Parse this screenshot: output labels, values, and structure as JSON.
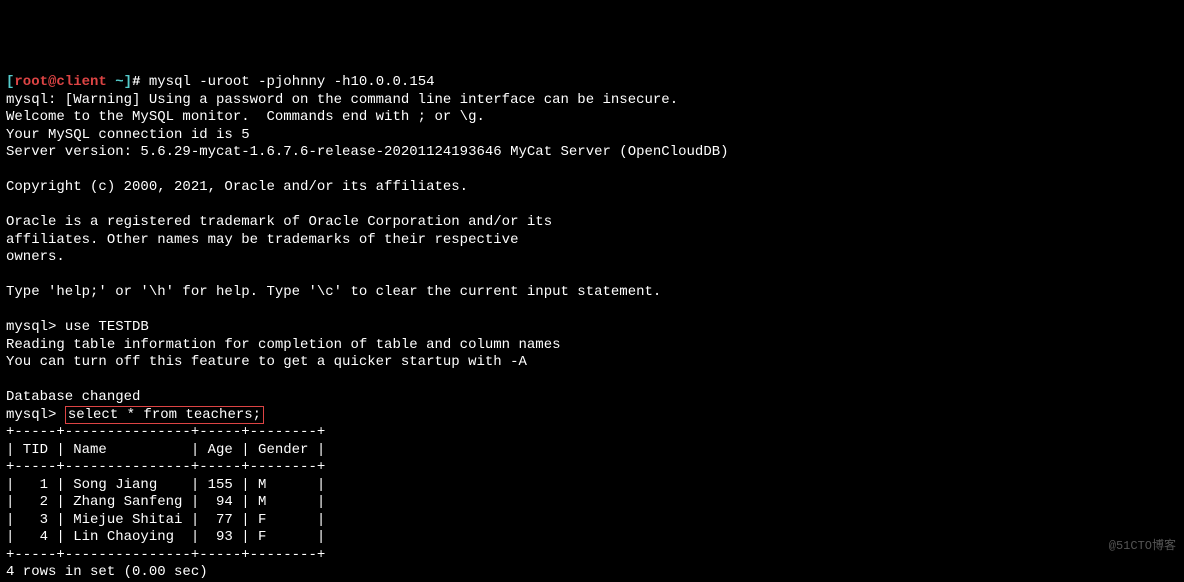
{
  "prompt": {
    "open": "[",
    "user": "root",
    "at": "@",
    "host": "client",
    "sep": " ",
    "tilde": "~",
    "close": "]",
    "hash": "#"
  },
  "command": "mysql -uroot -pjohnny -h10.0.0.154",
  "banner": {
    "l1": "mysql: [Warning] Using a password on the command line interface can be insecure.",
    "l2": "Welcome to the MySQL monitor.  Commands end with ; or \\g.",
    "l3": "Your MySQL connection id is 5",
    "l4": "Server version: 5.6.29-mycat-1.6.7.6-release-20201124193646 MyCat Server (OpenCloudDB)",
    "l5": "",
    "l6": "Copyright (c) 2000, 2021, Oracle and/or its affiliates.",
    "l7": "",
    "l8": "Oracle is a registered trademark of Oracle Corporation and/or its",
    "l9": "affiliates. Other names may be trademarks of their respective",
    "l10": "owners.",
    "l11": "",
    "l12": "Type 'help;' or '\\h' for help. Type '\\c' to clear the current input statement.",
    "l13": ""
  },
  "session": {
    "prompt1": "mysql> ",
    "cmd1": "use TESTDB",
    "out1a": "Reading table information for completion of table and column names",
    "out1b": "You can turn off this feature to get a quicker startup with -A",
    "out1c": "",
    "out1d": "Database changed",
    "prompt2": "mysql> ",
    "cmd2": "select * from teachers;"
  },
  "table": {
    "border": "+-----+---------------+-----+--------+",
    "header": "| TID | Name          | Age | Gender |",
    "rows": [
      "|   1 | Song Jiang    | 155 | M      |",
      "|   2 | Zhang Sanfeng |  94 | M      |",
      "|   3 | Miejue Shitai |  77 | F      |",
      "|   4 | Lin Chaoying  |  93 | F      |"
    ],
    "footer": "4 rows in set (0.00 sec)"
  },
  "watermark": "@51CTO博客"
}
